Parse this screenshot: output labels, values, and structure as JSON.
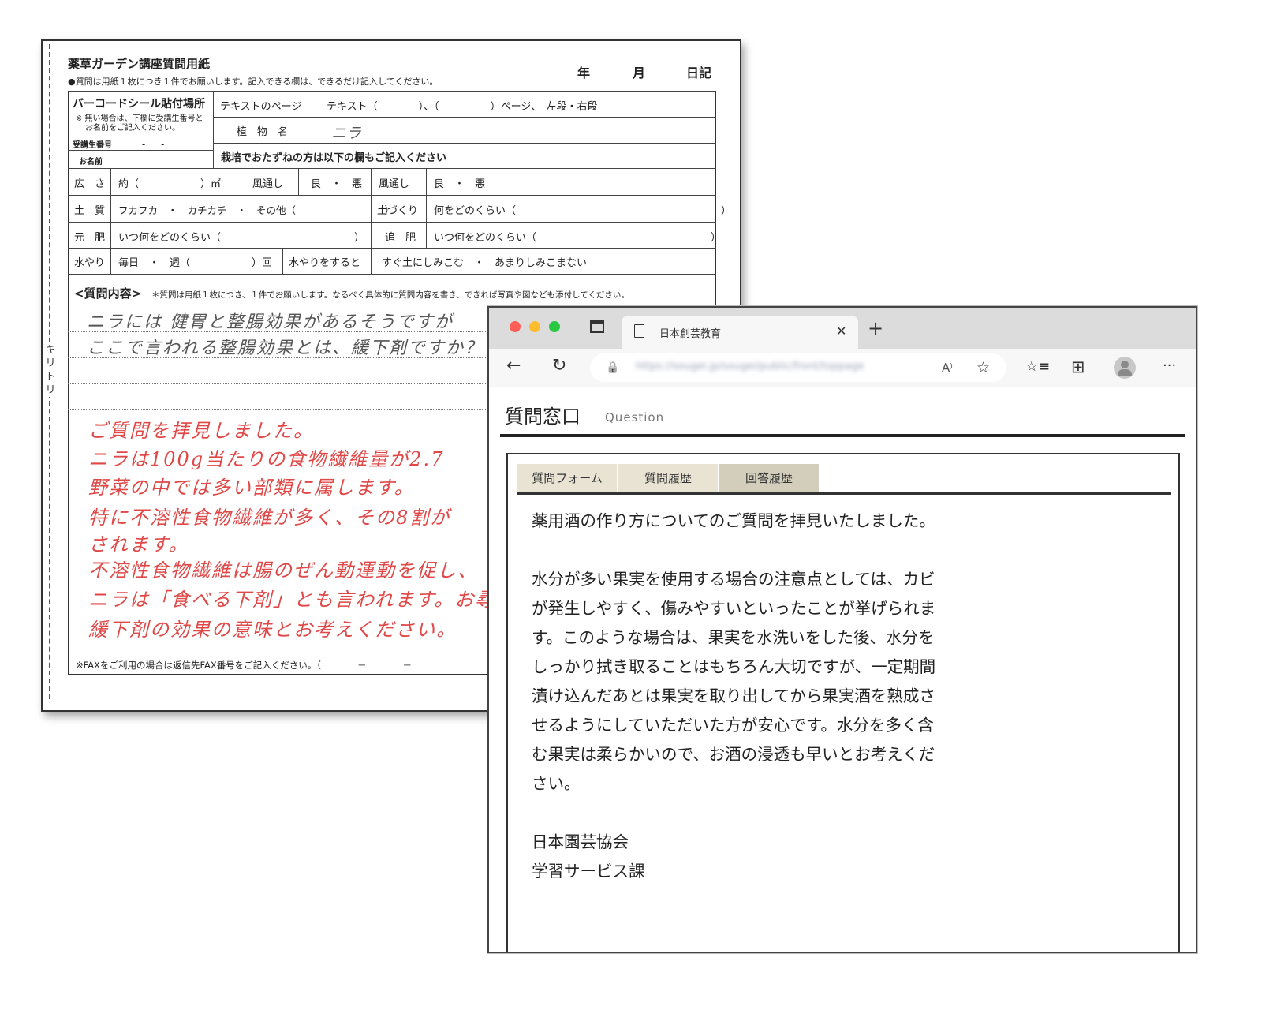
{
  "form": {
    "title": "薬草ガーデン講座質問用紙",
    "instruction": "●質問は用紙１枚につき１件でお願いします。記入できる欄は、できるだけ記入してください。",
    "date_year": "年",
    "date_month": "月",
    "date_day": "日記",
    "barcode_label": "バーコードシール貼付場所",
    "barcode_note_1": "※ 無い場合は、下欄に受講生番号と",
    "barcode_note_2": "お名前をご記入ください。",
    "student_number_label": "受講生番号",
    "student_number_value": "-　　-",
    "name_label": "お名前",
    "text_page_label": "テキストのページ",
    "text_page_value": "テキスト（　　　　）、（　　　　　）ページ、　左段・右段",
    "plant_name_label": "植　物　名",
    "plant_name_value": "ニラ",
    "cultivation_note": "栽培でおたずねの方は以下の欄もご記入ください",
    "rows": [
      {
        "c1": "広　さ",
        "c2": "約（　　　　　　）㎡",
        "c3": "風通し",
        "c4": "良　・　悪",
        "c5": "風通し",
        "c6": "良　・　悪"
      },
      {
        "c1": "土　質",
        "c2": "フカフカ　・　カチカチ　・　その他（　　　　　　　　　）",
        "c3": "土づくり",
        "c4": "何をどのくらい（　　　　　　　　　　　　　　　　　　　　）"
      },
      {
        "c1": "元　肥",
        "c2": "いつ何をどのくらい（　　　　　　　　　　　　　）",
        "c3": "追　肥",
        "c4": "いつ何をどのくらい（　　　　　　　　　　　　　　　　　）"
      },
      {
        "c1": "水やり",
        "c2": "毎日　・　週（　　　　　　）回",
        "c3": "水やりをすると",
        "c4": "すぐ土にしみこむ　・　あまりしみこまない"
      }
    ],
    "question_heading": "<質問内容>",
    "question_note": "＊質問は用紙１枚につき、１件でお願いします。なるべく具体的に質問内容を書き、できれば写真や図なども添付してください。",
    "handwritten_question": [
      "ニラには 健胃と整腸効果があるそうですが",
      "ここで言われる整腸効果とは、緩下剤ですか？ 下"
    ],
    "red_answer": [
      "ご質問を拝見しました。",
      "ニラは100g当たりの食物繊維量が2.7",
      "野菜の中では多い部類に属します。",
      "特に不溶性食物繊維が多く、その8割が",
      "されます。",
      "不溶性食物繊維は腸のぜん動運動を促し、",
      "ニラは「食べる下剤」とも言われます。お尋ねの",
      "緩下剤の効果の意味とお考えください。"
    ],
    "fax_note": "※FAXをご利用の場合は返信先FAX番号をご記入ください。（　　　　－　　　　－",
    "cut_label": "キリトリ"
  },
  "browser": {
    "tab_title": "日本創芸教育",
    "url": "https://sougei.jp/sougei/public/front/toppage",
    "icons": {
      "back": "←",
      "reload": "↻",
      "lock": "🔒",
      "read_aloud": "A⁾",
      "favorite_add": "☆",
      "favorites": "☆≡",
      "collections": "⊞",
      "profile": "●",
      "more": "···",
      "close": "✕",
      "new_tab": "+"
    },
    "colors": {
      "close": "#ff5f57",
      "minimize": "#febc2e",
      "maximize": "#28c840"
    }
  },
  "page": {
    "heading": "質問窓口",
    "subheading": "Question",
    "tabs": [
      "質問フォーム",
      "質問履歴",
      "回答履歴"
    ],
    "answer": {
      "p1": "薬用酒の作り方についてのご質問を拝見いたしました。",
      "p2": "水分が多い果実を使用する場合の注意点としては、カビが発生しやすく、傷みやすいといったことが挙げられます。このような場合は、果実を水洗いをした後、水分をしっかり拭き取ることはもちろん大切ですが、一定期間漬け込んだあとは果実を取り出してから果実酒を熟成させるようにしていただいた方が安心です。水分を多く含む果実は柔らかいので、お酒の浸透も早いとお考えください。",
      "signature_1": "日本園芸協会",
      "signature_2": "学習サービス課"
    }
  }
}
